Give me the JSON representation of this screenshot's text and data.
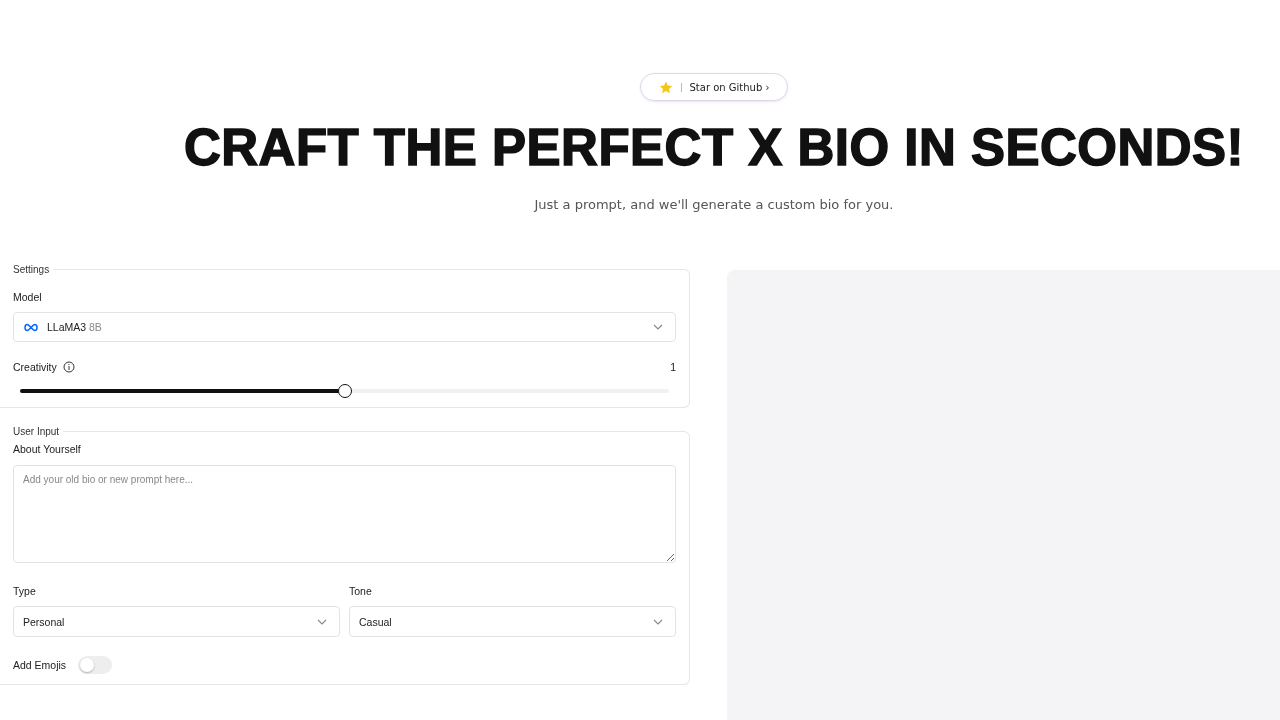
{
  "github_badge": {
    "label": "Star on Github",
    "chevron": "›"
  },
  "headline": "CRAFT THE PERFECT X BIO IN SECONDS!",
  "subtitle": "Just a prompt, and we'll generate a custom bio for you.",
  "settings": {
    "legend": "Settings",
    "model_label": "Model",
    "model": {
      "name": "LLaMA3",
      "size": "8B"
    },
    "creativity_label": "Creativity",
    "creativity_value": "1",
    "creativity": {
      "level": 0.5
    }
  },
  "user_input": {
    "legend": "User Input",
    "about_label": "About Yourself",
    "about_placeholder": "Add your old bio or new prompt here...",
    "selects": [
      {
        "label": "Type",
        "value": "Personal"
      },
      {
        "label": "Tone",
        "value": "Casual"
      }
    ],
    "emojis_label": "Add Emojis",
    "emojis": {
      "on": false
    }
  }
}
